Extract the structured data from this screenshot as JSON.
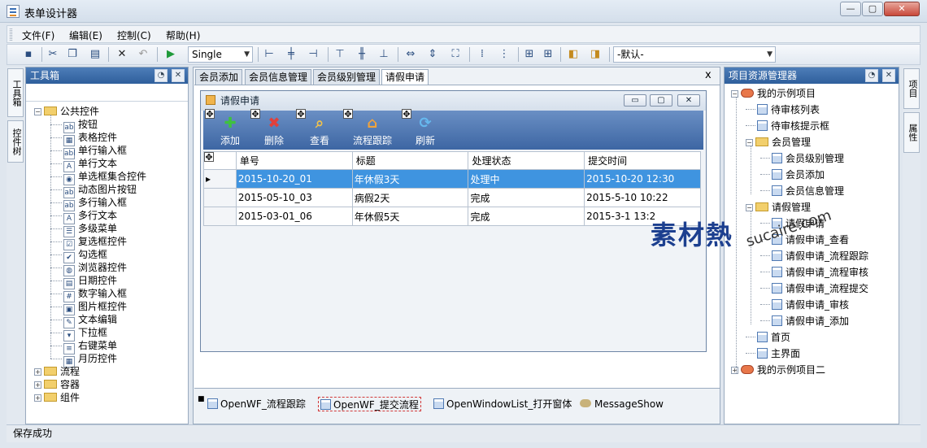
{
  "window": {
    "title": "表单设计器",
    "controls": {
      "minimize": "—",
      "maximize": "▢",
      "close": "✕"
    }
  },
  "menu": [
    "文件(F)",
    "编辑(E)",
    "控制(C)",
    "帮助(H)"
  ],
  "toolbar": {
    "font_select": "Single",
    "style_select": "-默认-"
  },
  "left_side_tabs": [
    "工具箱",
    "控件树"
  ],
  "right_side_tabs": [
    "项目",
    "属性"
  ],
  "toolbox": {
    "title": "工具箱",
    "groups": [
      {
        "label": "公共控件",
        "expanded": true,
        "items": [
          {
            "label": "按钮",
            "icon": "ab"
          },
          {
            "label": "表格控件",
            "icon": "▦"
          },
          {
            "label": "单行输入框",
            "icon": "abl"
          },
          {
            "label": "单行文本",
            "icon": "A"
          },
          {
            "label": "单选框集合控件",
            "icon": "◉"
          },
          {
            "label": "动态图片按钮",
            "icon": "ab"
          },
          {
            "label": "多行输入框",
            "icon": "ab"
          },
          {
            "label": "多行文本",
            "icon": "A"
          },
          {
            "label": "多级菜单",
            "icon": "☰"
          },
          {
            "label": "复选框控件",
            "icon": "☑"
          },
          {
            "label": "勾选框",
            "icon": "✔"
          },
          {
            "label": "浏览器控件",
            "icon": "◍"
          },
          {
            "label": "日期控件",
            "icon": "▤"
          },
          {
            "label": "数字输入框",
            "icon": "#"
          },
          {
            "label": "图片框控件",
            "icon": "▣"
          },
          {
            "label": "文本编辑",
            "icon": "✎"
          },
          {
            "label": "下拉框",
            "icon": "▾"
          },
          {
            "label": "右键菜单",
            "icon": "≡"
          },
          {
            "label": "月历控件",
            "icon": "▦"
          }
        ]
      },
      {
        "label": "流程",
        "expanded": false
      },
      {
        "label": "容器",
        "expanded": false
      },
      {
        "label": "组件",
        "expanded": false
      }
    ]
  },
  "doc_tabs": [
    "会员添加",
    "会员信息管理",
    "会员级别管理",
    "请假申请"
  ],
  "active_doc_tab": "请假申请",
  "doc_close": "x",
  "form": {
    "title": "请假申请",
    "buttons": {
      "minimize": "▭",
      "maximize": "▢",
      "close": "✕"
    },
    "ribbon": [
      {
        "label": "添加",
        "icon": "✚",
        "color": "#3ec23e"
      },
      {
        "label": "删除",
        "icon": "✖",
        "color": "#e2403a"
      },
      {
        "label": "查看",
        "icon": "⌕",
        "color": "#f2c24a"
      },
      {
        "label": "流程跟踪",
        "icon": "⌂",
        "color": "#f2a33a"
      },
      {
        "label": "刷新",
        "icon": "⟳",
        "color": "#66b8ee"
      }
    ],
    "grid": {
      "columns": [
        "单号",
        "标题",
        "处理状态",
        "提交时间"
      ],
      "rows": [
        {
          "marker": "▸",
          "cells": [
            "2015-10-20_01",
            "年休假3天",
            "处理中",
            "2015-10-20 12:30"
          ],
          "selected": true
        },
        {
          "marker": "",
          "cells": [
            "2015-05-10_03",
            "病假2天",
            "完成",
            "2015-5-10 10:22"
          ],
          "selected": false
        },
        {
          "marker": "",
          "cells": [
            "2015-03-01_06",
            "年休假5天",
            "完成",
            "2015-3-1 13:2"
          ],
          "selected": false
        }
      ]
    }
  },
  "components": [
    {
      "label": "OpenWF_流程跟踪",
      "selected": false
    },
    {
      "label": "OpenWF_提交流程",
      "selected": true
    },
    {
      "label": "OpenWindowList_打开窗体",
      "selected": false
    },
    {
      "label": "MessageShow",
      "selected": false
    }
  ],
  "project_explorer": {
    "title": "项目资源管理器",
    "nodes": [
      {
        "label": "我的示例项目",
        "level": 0,
        "type": "project",
        "toggle": "−"
      },
      {
        "label": "待审核列表",
        "level": 1,
        "type": "form"
      },
      {
        "label": "待审核提示框",
        "level": 1,
        "type": "form"
      },
      {
        "label": "会员管理",
        "level": 1,
        "type": "folder",
        "toggle": "−"
      },
      {
        "label": "会员级别管理",
        "level": 2,
        "type": "form"
      },
      {
        "label": "会员添加",
        "level": 2,
        "type": "form"
      },
      {
        "label": "会员信息管理",
        "level": 2,
        "type": "form"
      },
      {
        "label": "请假管理",
        "level": 1,
        "type": "folder",
        "toggle": "−"
      },
      {
        "label": "请假申请",
        "level": 2,
        "type": "form"
      },
      {
        "label": "请假申请_查看",
        "level": 2,
        "type": "form"
      },
      {
        "label": "请假申请_流程跟踪",
        "level": 2,
        "type": "form"
      },
      {
        "label": "请假申请_流程审核",
        "level": 2,
        "type": "form"
      },
      {
        "label": "请假申请_流程提交",
        "level": 2,
        "type": "form"
      },
      {
        "label": "请假申请_审核",
        "level": 2,
        "type": "form"
      },
      {
        "label": "请假申请_添加",
        "level": 2,
        "type": "form"
      },
      {
        "label": "首页",
        "level": 1,
        "type": "form"
      },
      {
        "label": "主界面",
        "level": 1,
        "type": "form"
      },
      {
        "label": "我的示例项目二",
        "level": 0,
        "type": "project",
        "toggle": "+"
      }
    ]
  },
  "status": "保存成功",
  "watermark": {
    "logo": "素材熱",
    "url": "sucaire.com"
  }
}
